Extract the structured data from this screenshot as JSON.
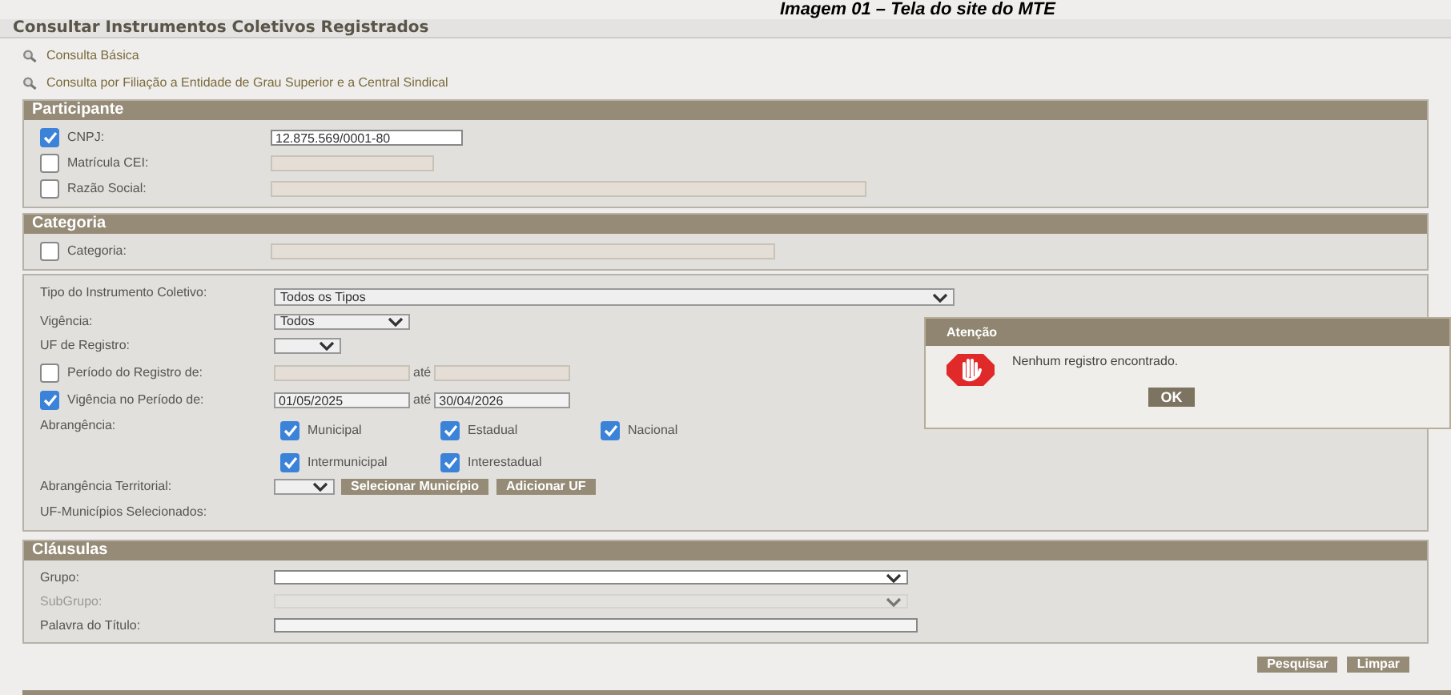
{
  "caption": "Imagem 01 – Tela do site do MTE",
  "page_title": "Consultar Instrumentos Coletivos Registrados",
  "links": [
    "Consulta Básica",
    "Consulta por Filiação a Entidade de Grau Superior e a Central Sindical"
  ],
  "participante": {
    "title": "Participante",
    "rows": [
      {
        "label": "CNPJ:",
        "checked": true,
        "value": "12.875.569/0001-80"
      },
      {
        "label": "Matrícula CEI:",
        "checked": false
      },
      {
        "label": "Razão Social:",
        "checked": false
      }
    ]
  },
  "categoria": {
    "title": "Categoria",
    "rows": [
      {
        "label": "Categoria:",
        "checked": false
      }
    ]
  },
  "filtros": {
    "tipo": {
      "label": "Tipo do Instrumento Coletivo:",
      "value": "Todos os Tipos"
    },
    "vigencia": {
      "label": "Vigência:",
      "value": "Todos"
    },
    "uf": {
      "label": "UF de Registro:"
    },
    "periodos": [
      {
        "label": "Período do Registro de:",
        "checked": false,
        "sep": "até"
      },
      {
        "label": "Vigência no Período de:",
        "checked": true,
        "from": "01/05/2025",
        "sep": "até",
        "to": "30/04/2026"
      }
    ],
    "abrangencia": {
      "label": "Abrangência:",
      "options": [
        {
          "label": "Municipal",
          "checked": true
        },
        {
          "label": "Estadual",
          "checked": true
        },
        {
          "label": "Nacional",
          "checked": true
        },
        {
          "label": "Intermunicipal",
          "checked": true
        },
        {
          "label": "Interestadual",
          "checked": true
        }
      ]
    },
    "territorial": {
      "label": "Abrangência Territorial:",
      "buttons": [
        "Selecionar Município",
        "Adicionar UF"
      ]
    },
    "selecionados": {
      "label": "UF-Municípios Selecionados:"
    }
  },
  "clausulas": {
    "title": "Cláusulas",
    "rows": [
      {
        "label": "Grupo:",
        "kind": "select",
        "disabled": false
      },
      {
        "label": "SubGrupo:",
        "kind": "select",
        "disabled": true
      },
      {
        "label": "Palavra do Título:",
        "kind": "text",
        "disabled": false
      }
    ]
  },
  "actions": [
    "Pesquisar",
    "Limpar"
  ],
  "dialog": {
    "title": "Atenção",
    "message": "Nenhum registro encontrado.",
    "button": "OK"
  }
}
